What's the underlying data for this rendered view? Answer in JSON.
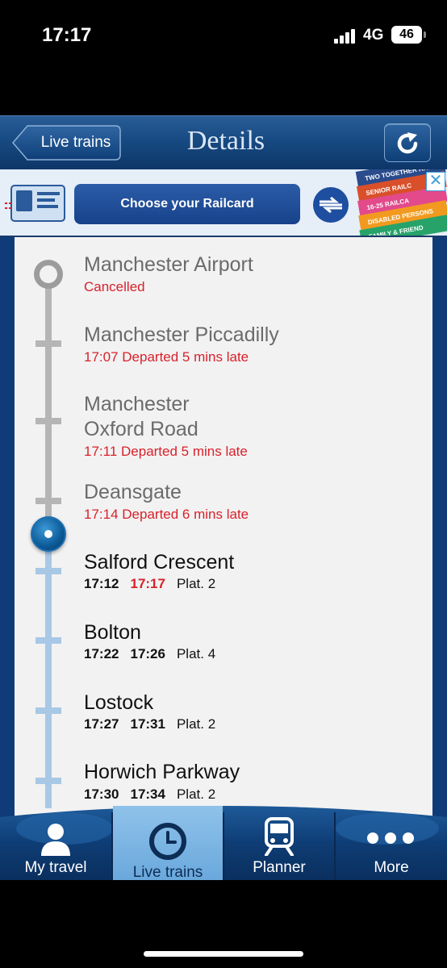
{
  "status_bar": {
    "time": "17:17",
    "network": "4G",
    "battery": "46"
  },
  "header": {
    "back_label": "Live trains",
    "title": "Details",
    "refresh_icon": "refresh-icon"
  },
  "ad": {
    "cta_label": "Choose your Railcard",
    "close_glyph": "✕",
    "card_texts": [
      "TWO TOGETHER RAIL",
      "SENIOR RAILC",
      "16-25 RAILCA",
      "DISABLED PERSONS",
      "FAMILY & FRIEND"
    ]
  },
  "stops": [
    {
      "name": "Manchester Airport",
      "status": "Cancelled",
      "state": "passed"
    },
    {
      "name": "Manchester Piccadilly",
      "status": "17:07 Departed 5 mins late",
      "state": "passed"
    },
    {
      "name_line1": "Manchester",
      "name_line2": "Oxford Road",
      "status": "17:11 Departed 5 mins late",
      "state": "passed"
    },
    {
      "name": "Deansgate",
      "status": "17:14 Departed 6 mins late",
      "state": "passed"
    },
    {
      "name": "Salford Crescent",
      "scheduled": "17:12",
      "expected": "17:17",
      "platform": "Plat. 2",
      "state": "upcoming",
      "expected_late": true
    },
    {
      "name": "Bolton",
      "scheduled": "17:22",
      "expected": "17:26",
      "platform": "Plat. 4",
      "state": "upcoming"
    },
    {
      "name": "Lostock",
      "scheduled": "17:27",
      "expected": "17:31",
      "platform": "Plat. 2",
      "state": "upcoming"
    },
    {
      "name": "Horwich Parkway",
      "scheduled": "17:30",
      "expected": "17:34",
      "platform": "Plat. 2",
      "state": "upcoming"
    }
  ],
  "tabs": [
    {
      "label": "My travel",
      "icon": "person-icon",
      "active": false
    },
    {
      "label": "Live trains",
      "icon": "clock-icon",
      "active": true
    },
    {
      "label": "Planner",
      "icon": "train-icon",
      "active": false
    },
    {
      "label": "More",
      "icon": "more-dots-icon",
      "active": false
    }
  ],
  "colors": {
    "brand_blue": "#0f3c78",
    "late_red": "#d9212b",
    "passed_track": "#b5b5b5",
    "upcoming_track": "#a8c8e6"
  }
}
